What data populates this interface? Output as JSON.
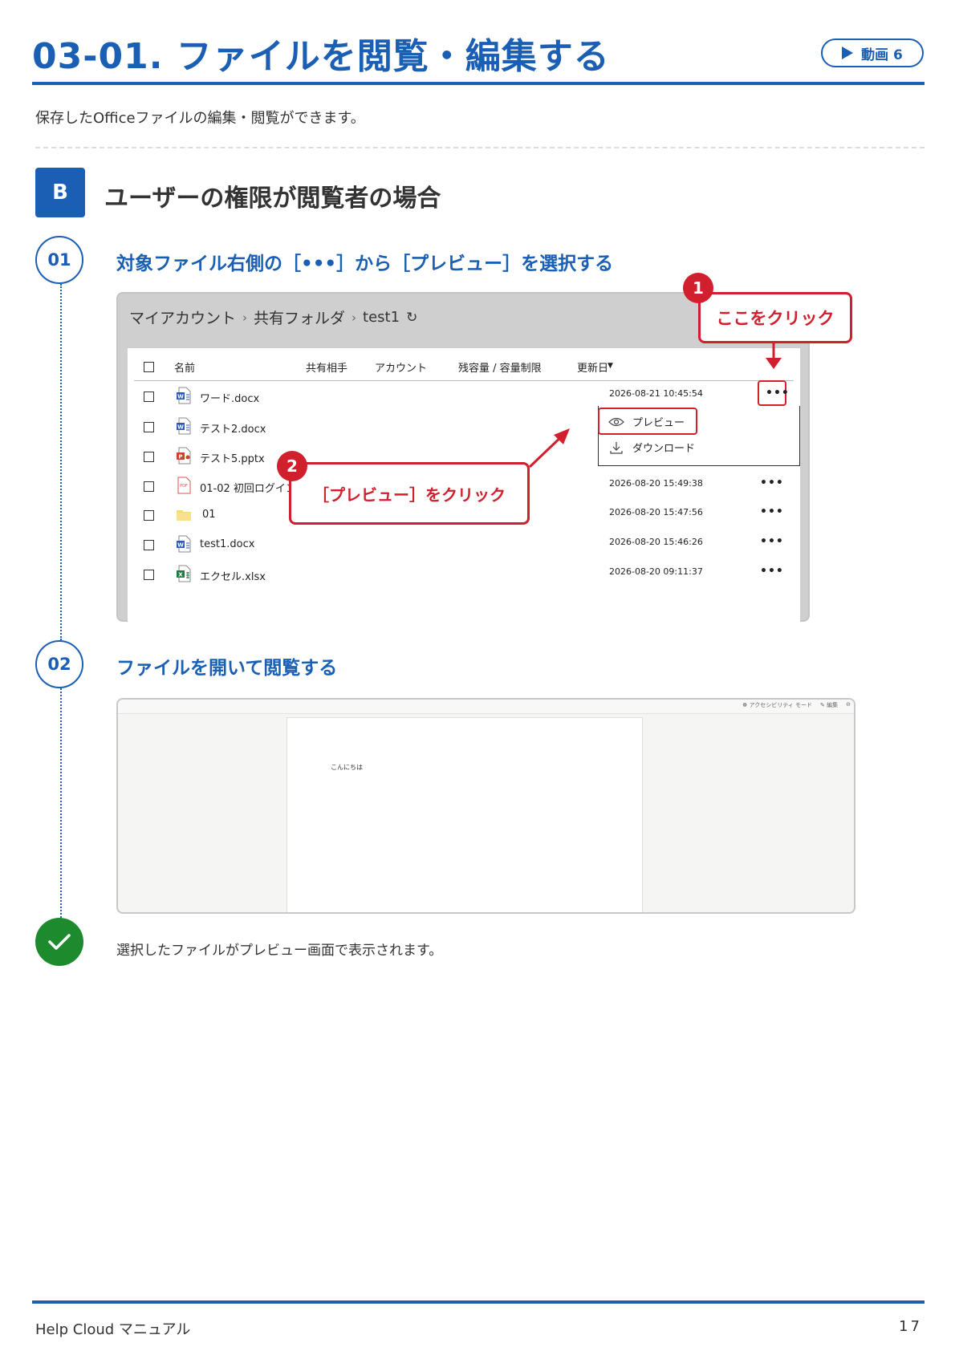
{
  "header": {
    "title": "03-01. ファイルを閲覧・編集する",
    "video_label": "動画 6"
  },
  "intro": "保存したOfficeファイルの編集・閲覧ができます。",
  "section": {
    "badge": "B",
    "title": "ユーザーの権限が閲覧者の場合"
  },
  "steps": [
    {
      "number": "01",
      "title": "対象ファイル右側の［•••］から［プレビュー］を選択する"
    },
    {
      "number": "02",
      "title": "ファイルを開いて閲覧する"
    }
  ],
  "screenshot1": {
    "breadcrumb": [
      "マイアカウント",
      "共有フォルダ",
      "test1"
    ],
    "columns": [
      "名前",
      "共有相手",
      "アカウント",
      "残容量 / 容量制限",
      "更新日"
    ],
    "rows": [
      {
        "name": "ワード.docx",
        "type": "word",
        "date": "2026-08-21 10:45:54"
      },
      {
        "name": "テスト2.docx",
        "type": "word",
        "date": ""
      },
      {
        "name": "テスト5.pptx",
        "type": "powerpoint",
        "date": ""
      },
      {
        "name": "01-02 初回ログイン",
        "type": "pdf",
        "date": "2026-08-20 15:49:38"
      },
      {
        "name": "01",
        "type": "folder",
        "date": "2026-08-20 15:47:56"
      },
      {
        "name": "test1.docx",
        "type": "word",
        "date": "2026-08-20 15:46:26"
      },
      {
        "name": "エクセル.xlsx",
        "type": "excel",
        "date": "2026-08-20 09:11:37"
      }
    ],
    "more_label": "•••",
    "menu": {
      "preview": "プレビュー",
      "download": "ダウンロード"
    },
    "callout1": {
      "number": "1",
      "text": "ここをクリック"
    },
    "callout2": {
      "number": "2",
      "text": "［プレビュー］をクリック"
    },
    "accent_color": "#d0202e"
  },
  "screenshot2": {
    "toolbar_accessibility": "アクセシビリティ モード",
    "toolbar_edit": "編集",
    "document_text": "こんにちは"
  },
  "result": "選択したファイルがプレビュー画面で表示されます。",
  "footer": {
    "left": "Help Cloud マニュアル",
    "page": "17"
  },
  "colors": {
    "primary": "#1a5fb4",
    "success": "#1e8a2e"
  }
}
